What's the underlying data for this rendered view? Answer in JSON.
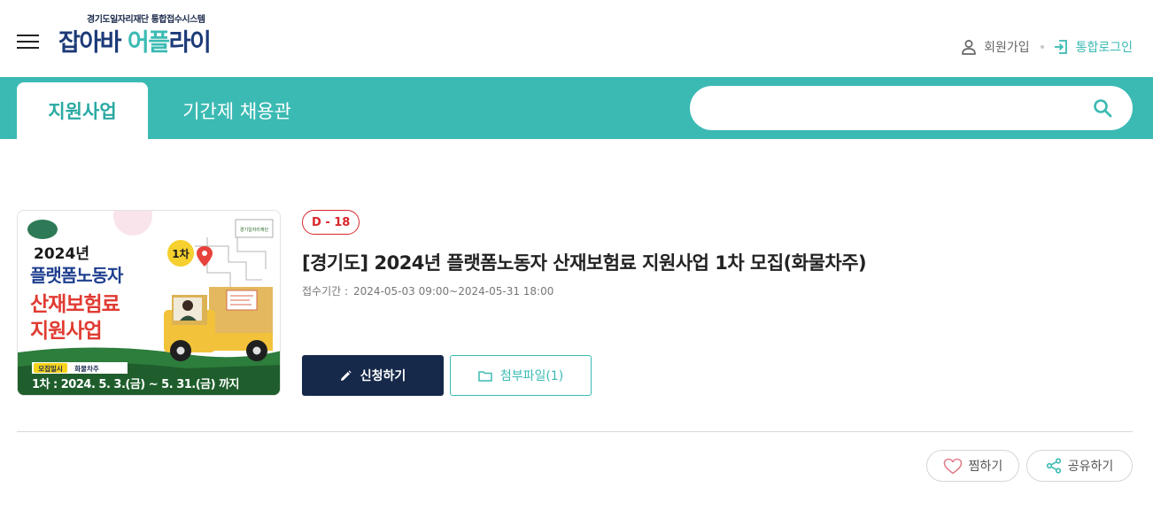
{
  "header": {
    "logo_sub": "경기도일자리재단 통합접수시스템",
    "logo_part1": "잡아바 ",
    "logo_part2": "어플",
    "logo_part3": "라이",
    "join_label": "회원가입",
    "login_label": "통합로그인"
  },
  "nav": {
    "tabs": [
      {
        "label": "지원사업",
        "active": true
      },
      {
        "label": "기간제 채용관",
        "active": false
      }
    ],
    "search_value": "",
    "search_icon": "search-icon"
  },
  "post": {
    "dday": "D - 18",
    "title": "[경기도] 2024년 플랫폼노동자 산재보험료 지원사업 1차 모집(화물차주)",
    "period_label": "접수기간 :",
    "period_value": "2024-05-03 09:00~2024-05-31 18:00",
    "apply_label": "신청하기",
    "attach_label": "첨부파일(1)",
    "thumbnail": {
      "year": "2024년",
      "line1": "플랫폼노동자",
      "line2": "산재보험료",
      "line3": "지원사업",
      "round_badge": "1차",
      "tag1": "모집일시",
      "tag2": "화물차주",
      "footer": "1차 : 2024. 5. 3.(금) ~ 5. 31.(금) 까지"
    }
  },
  "actions": {
    "like_label": "찜하기",
    "share_label": "공유하기"
  },
  "colors": {
    "teal": "#3bbab3",
    "navy": "#16294a",
    "dday_red": "#d7262a",
    "logo_navy": "#1c3a78"
  }
}
